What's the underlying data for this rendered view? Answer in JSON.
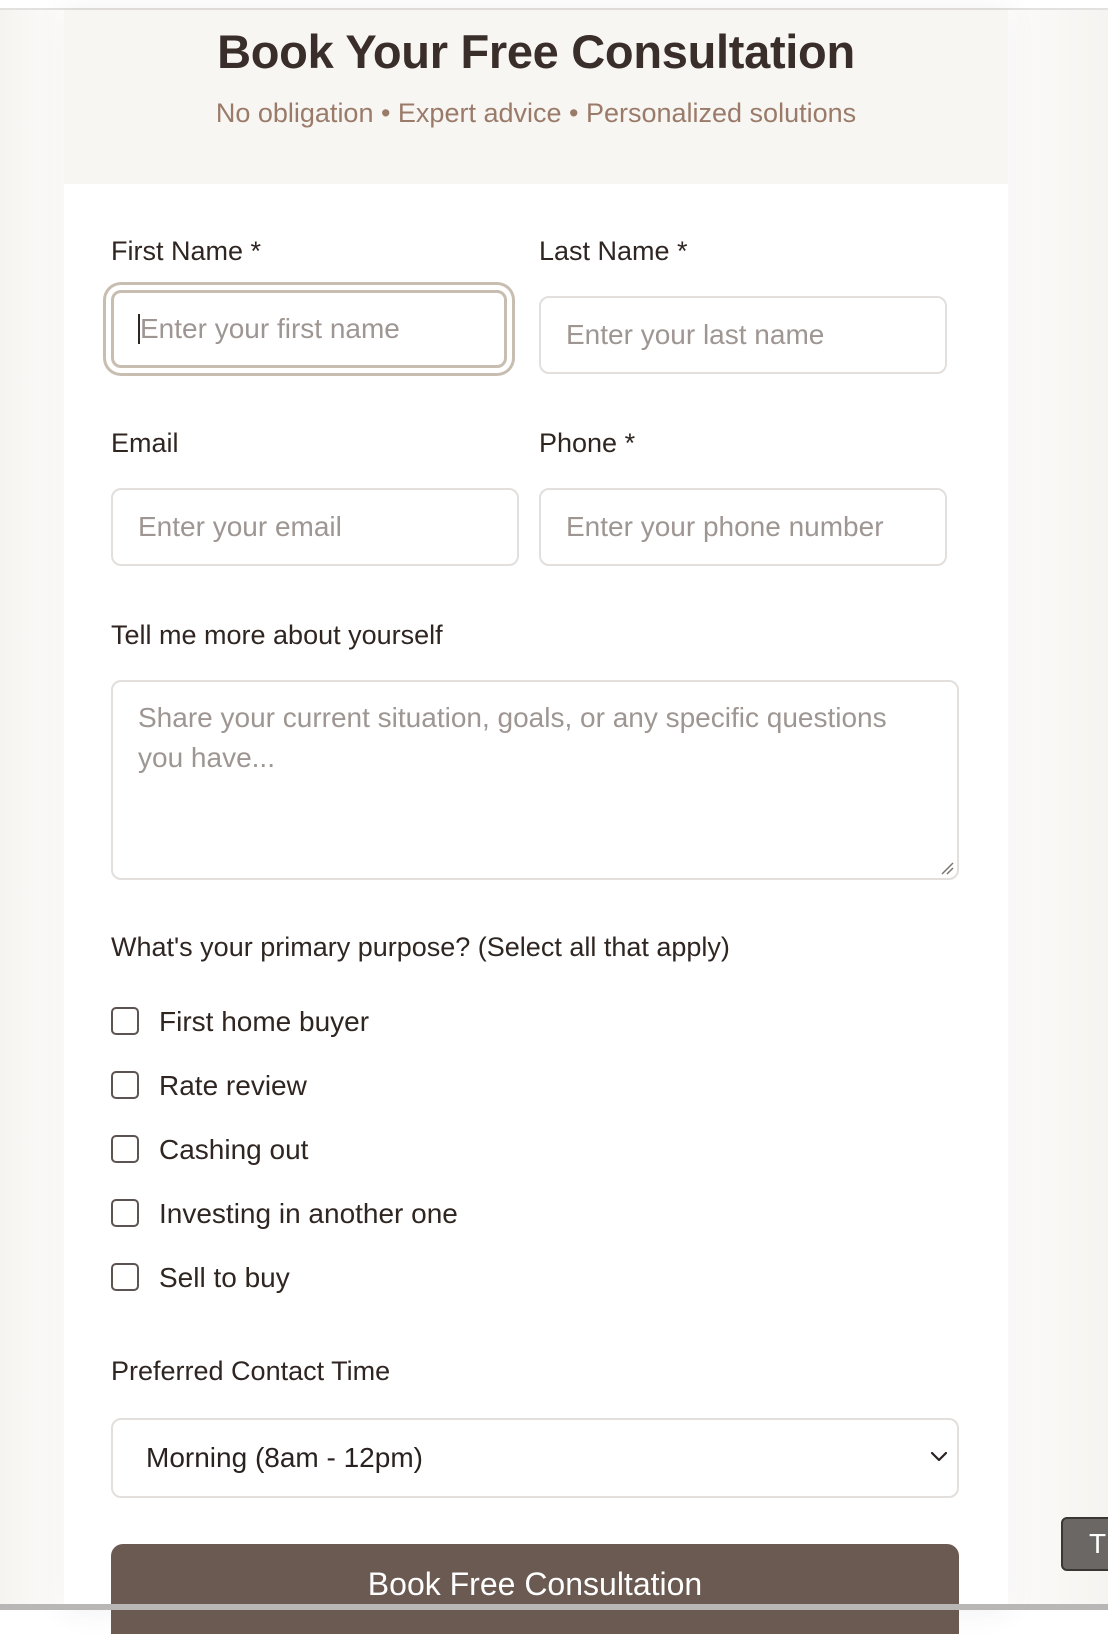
{
  "header": {
    "title": "Book Your Free Consultation",
    "subtitle": "No obligation • Expert advice • Personalized solutions"
  },
  "form": {
    "first_name": {
      "label": "First Name *",
      "placeholder": "Enter your first name",
      "focused": true
    },
    "last_name": {
      "label": "Last Name *",
      "placeholder": "Enter your last name"
    },
    "email": {
      "label": "Email",
      "placeholder": "Enter your email"
    },
    "phone": {
      "label": "Phone *",
      "placeholder": "Enter your phone number"
    },
    "about": {
      "label": "Tell me more about yourself",
      "placeholder": "Share your current situation, goals, or any specific questions you have..."
    },
    "purpose": {
      "label": "What's your primary purpose? (Select all that apply)",
      "options": [
        {
          "label": "First home buyer",
          "checked": false
        },
        {
          "label": "Rate review",
          "checked": false
        },
        {
          "label": "Cashing out",
          "checked": false
        },
        {
          "label": "Investing in another one",
          "checked": false
        },
        {
          "label": "Sell to buy",
          "checked": false
        }
      ]
    },
    "contact_time": {
      "label": "Preferred Contact Time",
      "selected": "Morning (8am - 12pm)"
    },
    "submit_label": "Book Free Consultation"
  },
  "floating_button": {
    "label": "T"
  },
  "icons": {
    "select_arrow": "chevron-down-icon",
    "textarea_grip": "resize-grip-icon"
  }
}
